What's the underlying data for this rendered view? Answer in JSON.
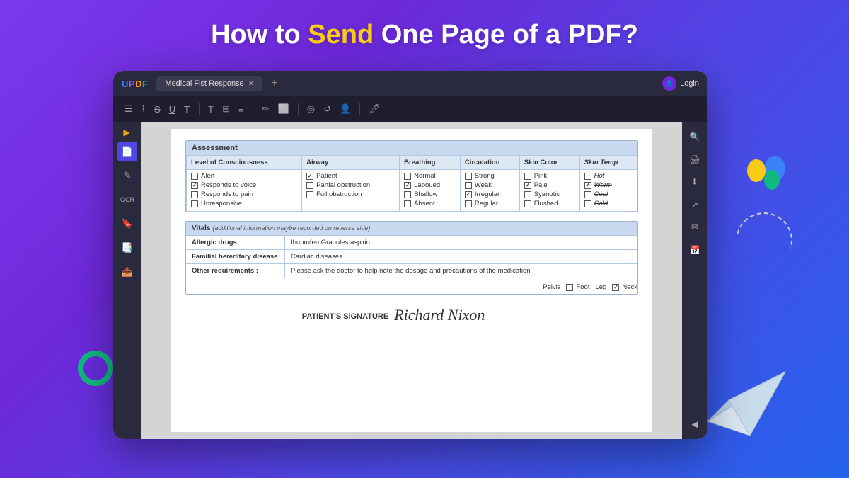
{
  "page": {
    "heading": "How to Send One Page of a PDF?",
    "heading_plain": "How to ",
    "heading_highlight": "Send",
    "heading_end": " One Page of a PDF?"
  },
  "app": {
    "logo": "UPDF",
    "tab_title": "Medical Fist Response",
    "login_label": "Login"
  },
  "toolbar": {
    "icons": [
      "≡",
      "⌶",
      "S̶",
      "U̲",
      "T",
      "T",
      "T≡",
      "≡≡",
      "|",
      "✏",
      "□⊞",
      "|",
      "◎",
      "↩",
      "👤",
      "|",
      "🖊"
    ]
  },
  "sidebar": {
    "left_icons": [
      "📄",
      "✎",
      "📋",
      "🗂",
      "📁"
    ]
  },
  "assessment": {
    "header": "Assessment",
    "columns": {
      "consciousness": {
        "header": "Level of Consciousness",
        "items": [
          {
            "label": "Alert",
            "checked": false
          },
          {
            "label": "Responds to voice",
            "checked": true
          },
          {
            "label": "Responds to pain",
            "checked": false
          },
          {
            "label": "Unresponsive",
            "checked": false
          }
        ]
      },
      "airway": {
        "header": "Airway",
        "items": [
          {
            "label": "Patient",
            "checked": true
          },
          {
            "label": "Partial obstruction",
            "checked": false
          },
          {
            "label": "Full obstruction",
            "checked": false
          }
        ]
      },
      "breathing": {
        "header": "Breathing",
        "items": [
          {
            "label": "Normal",
            "checked": false
          },
          {
            "label": "Laboued",
            "checked": true
          },
          {
            "label": "Shallow",
            "checked": false
          },
          {
            "label": "Absent",
            "checked": false
          }
        ]
      },
      "circulation": {
        "header": "Circulation",
        "items": [
          {
            "label": "Strong",
            "checked": false
          },
          {
            "label": "Weak",
            "checked": false
          },
          {
            "label": "Irregular",
            "checked": true
          },
          {
            "label": "Regular",
            "checked": false
          }
        ]
      },
      "skin_color": {
        "header": "Skin Color",
        "items": [
          {
            "label": "Pink",
            "checked": false
          },
          {
            "label": "Pale",
            "checked": true
          },
          {
            "label": "Syanotic",
            "checked": false
          },
          {
            "label": "Flushed",
            "checked": false
          }
        ]
      },
      "skin_temp": {
        "header": "Skin Temp",
        "items": [
          {
            "label": "Hot",
            "checked": false
          },
          {
            "label": "Warm",
            "checked": true
          },
          {
            "label": "Cool",
            "checked": false
          },
          {
            "label": "Cold",
            "checked": false
          }
        ]
      }
    }
  },
  "vitals": {
    "header": "Vitals",
    "sub_header": "(additional information maybe recorded on reverse side)",
    "rows": [
      {
        "label": "Allergic drugs",
        "value": "Ibuprofen Granules  aspirin"
      },
      {
        "label": "Familial hereditary disease",
        "value": "Cardiac diseases"
      },
      {
        "label": "Other requirements :",
        "value": "Please ask the doctor to help note the dosage and precautions of the medication"
      }
    ]
  },
  "body_checks": {
    "items": [
      {
        "side": "Pelvis",
        "check_label": "Foot",
        "checked": false
      },
      {
        "side": "Leg",
        "check_label": "Neck",
        "checked": true
      }
    ]
  },
  "signature": {
    "label": "PATIENT'S SIGNATURE",
    "name": "Richard Nixon"
  }
}
